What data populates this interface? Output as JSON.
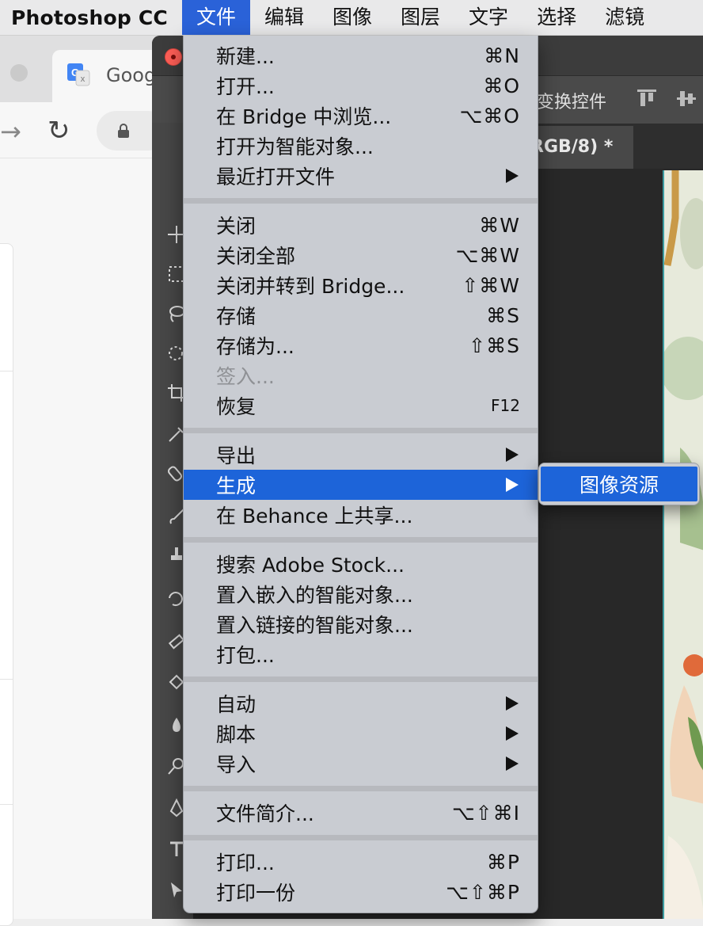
{
  "menubar": {
    "app_name": "Photoshop CC",
    "items": [
      {
        "label": "文件",
        "active": true
      },
      {
        "label": "编辑",
        "active": false
      },
      {
        "label": "图像",
        "active": false
      },
      {
        "label": "图层",
        "active": false
      },
      {
        "label": "文字",
        "active": false
      },
      {
        "label": "选择",
        "active": false
      },
      {
        "label": "滤镜",
        "active": false
      }
    ]
  },
  "browser": {
    "tab_title": "Goog"
  },
  "photoshop": {
    "options_bar": {
      "transform_controls_label": "变换控件"
    },
    "document_tab": {
      "label": "RGB/8) *"
    },
    "panel_collapse_glyph": "»"
  },
  "file_menu": {
    "groups": [
      [
        {
          "label": "新建...",
          "shortcut": "⌘N"
        },
        {
          "label": "打开...",
          "shortcut": "⌘O"
        },
        {
          "label": "在 Bridge 中浏览...",
          "shortcut": "⌥⌘O"
        },
        {
          "label": "打开为智能对象...",
          "shortcut": ""
        },
        {
          "label": "最近打开文件",
          "shortcut": "",
          "submenu": true
        }
      ],
      [
        {
          "label": "关闭",
          "shortcut": "⌘W"
        },
        {
          "label": "关闭全部",
          "shortcut": "⌥⌘W"
        },
        {
          "label": "关闭并转到 Bridge...",
          "shortcut": "⇧⌘W"
        },
        {
          "label": "存储",
          "shortcut": "⌘S"
        },
        {
          "label": "存储为...",
          "shortcut": "⇧⌘S"
        },
        {
          "label": "签入...",
          "shortcut": "",
          "disabled": true
        },
        {
          "label": "恢复",
          "shortcut": "F12",
          "small_shortcut": true
        }
      ],
      [
        {
          "label": "导出",
          "shortcut": "",
          "submenu": true
        },
        {
          "label": "生成",
          "shortcut": "",
          "submenu": true,
          "highlighted": true
        },
        {
          "label": "在 Behance 上共享...",
          "shortcut": ""
        }
      ],
      [
        {
          "label": "搜索 Adobe Stock...",
          "shortcut": ""
        },
        {
          "label": "置入嵌入的智能对象...",
          "shortcut": ""
        },
        {
          "label": "置入链接的智能对象...",
          "shortcut": ""
        },
        {
          "label": "打包...",
          "shortcut": ""
        }
      ],
      [
        {
          "label": "自动",
          "shortcut": "",
          "submenu": true
        },
        {
          "label": "脚本",
          "shortcut": "",
          "submenu": true
        },
        {
          "label": "导入",
          "shortcut": "",
          "submenu": true
        }
      ],
      [
        {
          "label": "文件简介...",
          "shortcut": "⌥⇧⌘I"
        }
      ],
      [
        {
          "label": "打印...",
          "shortcut": "⌘P"
        },
        {
          "label": "打印一份",
          "shortcut": "⌥⇧⌘P"
        }
      ]
    ]
  },
  "generate_submenu": {
    "items": [
      {
        "label": "图像资源",
        "highlighted": true
      }
    ]
  },
  "colors": {
    "menu_highlight": "#1d64d9",
    "menubar_active": "#2a62d8",
    "menu_background": "#c9ccd2",
    "disabled_text": "#8f9195",
    "ps_close_button": "#ff5f57"
  }
}
